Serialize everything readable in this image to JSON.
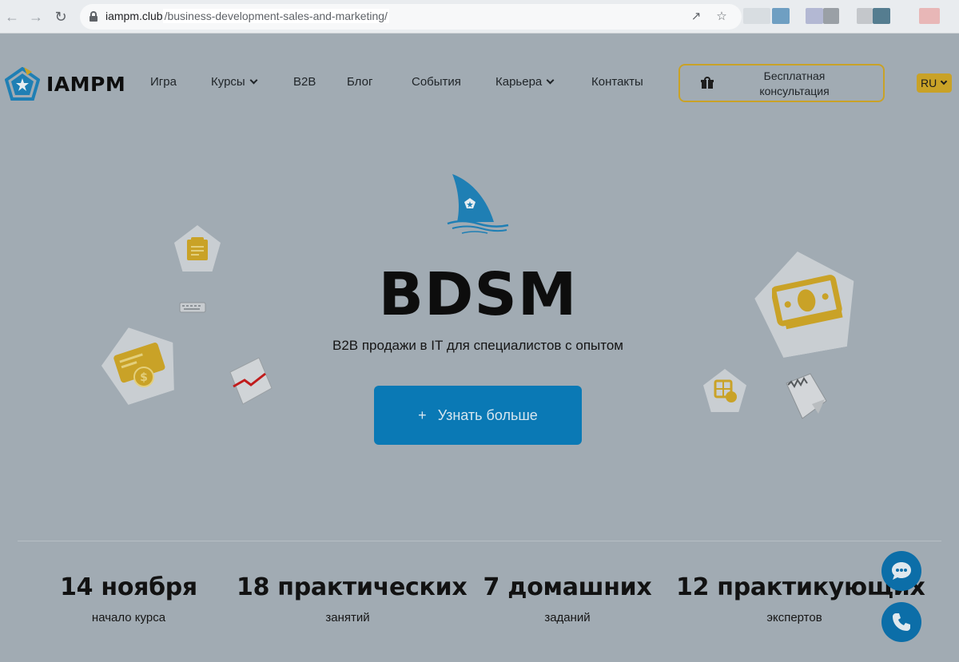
{
  "browser": {
    "url_host": "iampm.club",
    "url_path": "/business-development-sales-and-marketing/"
  },
  "header": {
    "logo_text": "IAMPM",
    "nav": [
      {
        "label": "Игра",
        "has_dropdown": false
      },
      {
        "label": "Курсы",
        "has_dropdown": true
      },
      {
        "label": "B2B",
        "has_dropdown": false
      },
      {
        "label": "Блог",
        "has_dropdown": false
      },
      {
        "label": "События",
        "has_dropdown": false
      },
      {
        "label": "Карьера",
        "has_dropdown": true
      },
      {
        "label": "Контакты",
        "has_dropdown": false
      }
    ],
    "consult_line1": "Бесплатная",
    "consult_line2": "консультация",
    "lang": "RU"
  },
  "hero": {
    "title": "BDSM",
    "subtitle": "B2B продажи в IT для специалистов с опытом",
    "cta_icon": "+",
    "cta_label": "Узнать больше"
  },
  "stats": [
    {
      "value": "14 ноября",
      "label": "начало курса"
    },
    {
      "value": "18 практических",
      "label": "занятий"
    },
    {
      "value": "7 домашних",
      "label": "заданий"
    },
    {
      "value": "12 практикующих",
      "label": "экспертов"
    }
  ],
  "colors": {
    "background": "#a1abb3",
    "accent_gold": "#c9a227",
    "cta_blue": "#0a79b5",
    "brand_blue": "#1f7fb4"
  },
  "icons": {
    "chat": "chat-bubble-icon",
    "phone": "phone-icon",
    "gift": "gift-icon"
  }
}
